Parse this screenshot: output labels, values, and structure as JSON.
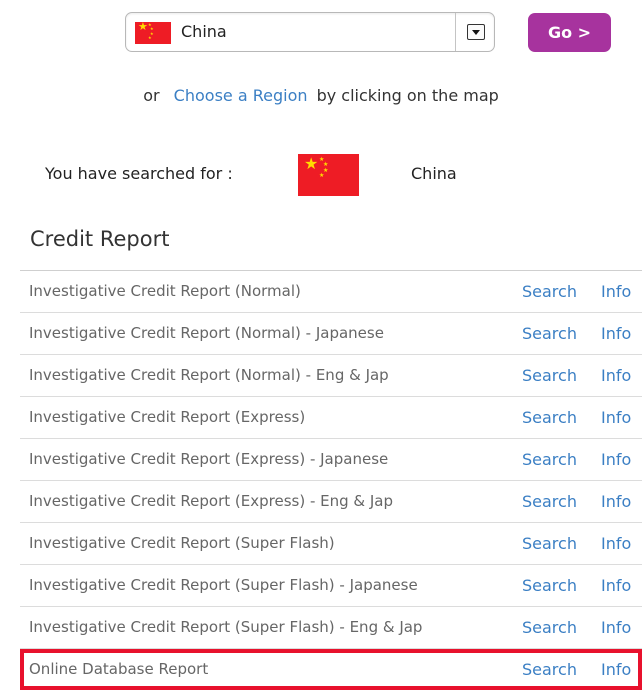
{
  "country_select": {
    "value": "China",
    "flag": "china-flag"
  },
  "go_button": {
    "label": "Go >",
    "color": "#a7339e"
  },
  "region_line": {
    "prefix": "or",
    "link": "Choose a Region",
    "suffix": "by clicking on the map"
  },
  "searched": {
    "label": "You have searched for :",
    "country": "China"
  },
  "section_title": "Credit Report",
  "reports": [
    {
      "name": "Investigative Credit Report (Normal)",
      "search": "Search",
      "info": "Info"
    },
    {
      "name": "Investigative Credit Report (Normal) - Japanese",
      "search": "Search",
      "info": "Info"
    },
    {
      "name": "Investigative Credit Report (Normal) - Eng & Jap",
      "search": "Search",
      "info": "Info"
    },
    {
      "name": "Investigative Credit Report (Express)",
      "search": "Search",
      "info": "Info"
    },
    {
      "name": "Investigative Credit Report (Express) - Japanese",
      "search": "Search",
      "info": "Info"
    },
    {
      "name": "Investigative Credit Report (Express) - Eng & Jap",
      "search": "Search",
      "info": "Info"
    },
    {
      "name": "Investigative Credit Report (Super Flash)",
      "search": "Search",
      "info": "Info"
    },
    {
      "name": "Investigative Credit Report (Super Flash) - Japanese",
      "search": "Search",
      "info": "Info"
    },
    {
      "name": "Investigative Credit Report (Super Flash) - Eng & Jap",
      "search": "Search",
      "info": "Info"
    },
    {
      "name": "Online Database Report",
      "search": "Search",
      "info": "Info",
      "highlighted": true
    }
  ],
  "colors": {
    "link": "#3b7fc4",
    "highlight": "#e8112d",
    "flag_red": "#ee1c25",
    "flag_star": "#ffde00"
  }
}
